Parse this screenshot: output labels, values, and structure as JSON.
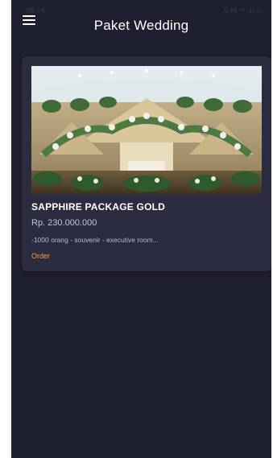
{
  "statusbar": {
    "time": "08.04",
    "right": "0 M ᵃᵗˡ .ıl ▭"
  },
  "appbar": {
    "title": "Paket Wedding",
    "menu_icon": "hamburger-menu-icon"
  },
  "packages": [
    {
      "name": "SAPPHIRE PACKAGE GOLD",
      "price": "Rp. 230.000.000",
      "description": "-1000 orang - souvenir - executive room...",
      "action_label": "Order",
      "image_semantic": "wedding-stage-decoration-photo"
    }
  ],
  "colors": {
    "background": "#1e1f2f",
    "card": "#2b2c40",
    "title_text": "#ffffff",
    "accent_order": "#f2a13a"
  }
}
